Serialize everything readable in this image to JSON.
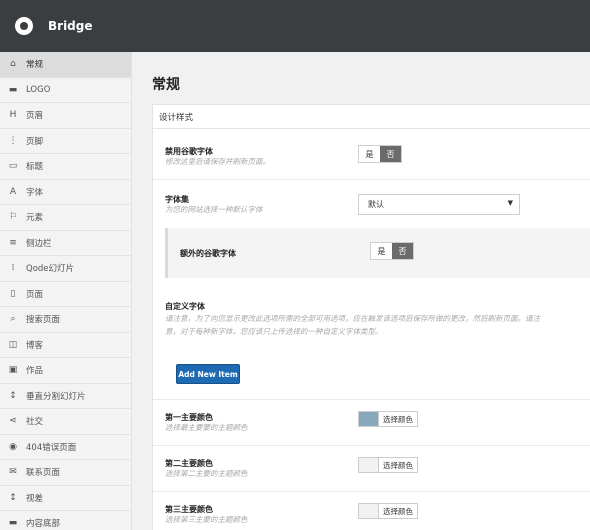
{
  "app": {
    "brand": "Bridge"
  },
  "sidebar": {
    "items": [
      {
        "label": "常规",
        "icon": "bank-icon",
        "glyph": "⌂"
      },
      {
        "label": "LOGO",
        "icon": "coffee-icon",
        "glyph": "▬"
      },
      {
        "label": "页眉",
        "icon": "header-icon",
        "glyph": "H"
      },
      {
        "label": "页脚",
        "icon": "footer-icon",
        "glyph": "⋮"
      },
      {
        "label": "标题",
        "icon": "title-icon",
        "glyph": "▭"
      },
      {
        "label": "字体",
        "icon": "font-icon",
        "glyph": "A"
      },
      {
        "label": "元素",
        "icon": "flag-icon",
        "glyph": "⚐"
      },
      {
        "label": "侧边栏",
        "icon": "menu-icon",
        "glyph": "≡"
      },
      {
        "label": "Qode幻灯片",
        "icon": "slides-icon",
        "glyph": "⁞"
      },
      {
        "label": "页面",
        "icon": "page-icon",
        "glyph": "▯"
      },
      {
        "label": "搜索页面",
        "icon": "search-icon",
        "glyph": "⌕"
      },
      {
        "label": "博客",
        "icon": "blog-icon",
        "glyph": "◫"
      },
      {
        "label": "作品",
        "icon": "image-icon",
        "glyph": "▣"
      },
      {
        "label": "垂直分割幻灯片",
        "icon": "vertical-split-icon",
        "glyph": "↕"
      },
      {
        "label": "社交",
        "icon": "share-icon",
        "glyph": "⋖"
      },
      {
        "label": "404错误页面",
        "icon": "error-icon",
        "glyph": "◉"
      },
      {
        "label": "联系页面",
        "icon": "mail-icon",
        "glyph": "✉"
      },
      {
        "label": "视差",
        "icon": "parallax-icon",
        "glyph": "↕"
      },
      {
        "label": "内容底部",
        "icon": "content-bottom-icon",
        "glyph": "▬"
      }
    ]
  },
  "main": {
    "title": "常规",
    "section": "设计样式",
    "disable_google_fonts": {
      "title": "禁用谷歌字体",
      "desc": "修改这里后请保存并刷新页面。",
      "yes": "是",
      "no": "否"
    },
    "font_set": {
      "title": "字体集",
      "desc": "为您的网站选择一种默认字体",
      "selected": "默认"
    },
    "extra_google_fonts": {
      "title": "额外的谷歌字体",
      "yes": "是",
      "no": "否"
    },
    "custom_fonts": {
      "title": "自定义字体",
      "desc": "请注意，为了向您显示更改此选项所需的全部可用选项，应在触发该选项后保存所做的更改，然后刷新页面。请注意，对于每种新字体，您应该只上传选择的一种自定义字体类型。",
      "button": "Add New Item"
    },
    "colors": [
      {
        "title": "第一主要颜色",
        "desc": "选择最主要要的主题颜色",
        "button": "选择颜色",
        "value": "#88a8bb"
      },
      {
        "title": "第二主要颜色",
        "desc": "选择第二主要的主题颜色",
        "button": "选择颜色",
        "value": "#f2f2f2"
      },
      {
        "title": "第三主要颜色",
        "desc": "选择第三主要的主题颜色",
        "button": "选择颜色",
        "value": "#f2f2f2"
      }
    ]
  }
}
